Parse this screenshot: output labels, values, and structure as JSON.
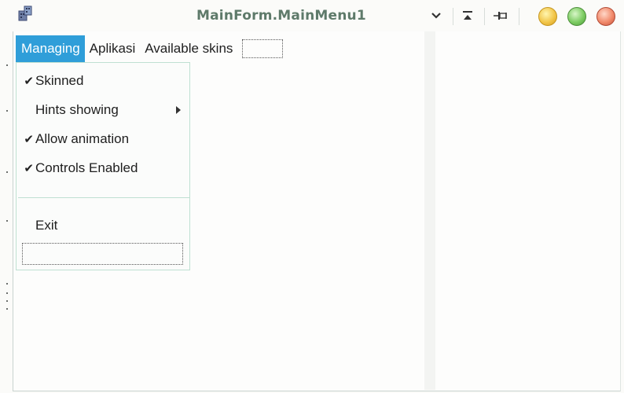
{
  "window": {
    "title": "MainForm.MainMenu1"
  },
  "titlebar_icons": {
    "app_icon": "app-icon",
    "dropdown_icon": "chevron-down-icon",
    "move_top_icon": "move-to-top-icon",
    "pin_icon": "pin-icon",
    "minimize_orb_color": "#f2c64a",
    "maximize_orb_color": "#7dcc63",
    "close_orb_color": "#f18a6b"
  },
  "menubar": {
    "items": [
      {
        "label": "Managing",
        "active": true
      },
      {
        "label": "Aplikasi",
        "active": false
      },
      {
        "label": "Available skins",
        "active": false
      }
    ]
  },
  "dropdown": {
    "items": [
      {
        "label": "Skinned",
        "checked": true
      },
      {
        "label": "Hints showing",
        "checked": false,
        "submenu": true
      },
      {
        "label": "Allow animation",
        "checked": true
      },
      {
        "label": "Controls Enabled",
        "checked": true
      },
      {
        "label": "Exit",
        "checked": false
      }
    ],
    "check_glyph": "✔"
  },
  "colors": {
    "accent": "#2f9ed9",
    "title_text": "#5e7a6a",
    "menu_border": "#bfe0d2"
  }
}
